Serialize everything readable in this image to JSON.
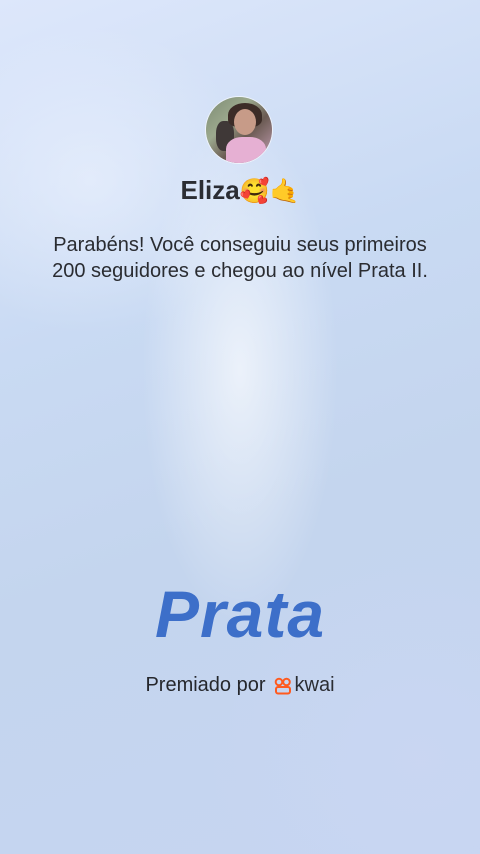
{
  "user": {
    "name": "Eliza",
    "name_emoji": "🥰🤙"
  },
  "message": "Parabéns! Você conseguiu seus primeiros 200 seguidores e chegou ao nível Prata II.",
  "tier": {
    "label": "Prata"
  },
  "award": {
    "prefix": "Premiado por",
    "brand": "kwai",
    "brand_icon": "kwai-logo-icon",
    "brand_color": "#ff5a1f"
  }
}
